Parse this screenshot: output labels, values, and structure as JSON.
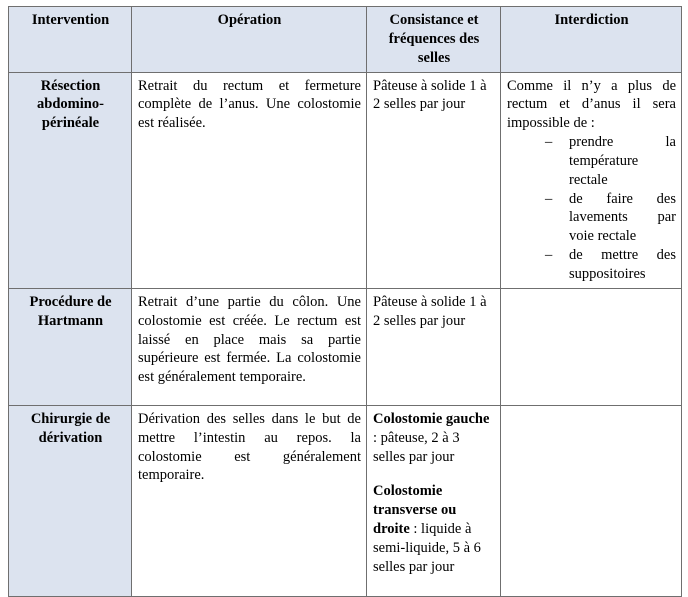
{
  "table": {
    "headers": [
      {
        "id": "intervention",
        "label": "Intervention"
      },
      {
        "id": "operation",
        "label": "Opération"
      },
      {
        "id": "consistance",
        "label": "Consistance et fréquences des selles"
      },
      {
        "id": "interdiction",
        "label": "Interdiction"
      }
    ],
    "rows": [
      {
        "intervention": "Résection abdomino-périnéale",
        "operation": "Retrait du rectum et fermeture complète de l’anus. Une colostomie est réalisée.",
        "consistance": [
          {
            "lead": "",
            "text": "Pâteuse à solide 1 à 2 selles par jour"
          }
        ],
        "interdiction_intro": "Comme il n’y a plus de rectum et d’anus il sera impossible de :",
        "interdiction_items": [
          "prendre la température rectale",
          "de faire des lavements par voie rectale",
          "de mettre des suppositoires"
        ],
        "dash": "–"
      },
      {
        "intervention": "Procédure de Hartmann",
        "operation": "Retrait d’une partie du côlon. Une colostomie est créée. Le rectum est laissé en place mais sa partie supérieure est fermée. La colostomie est généralement temporaire.",
        "consistance": [
          {
            "lead": "",
            "text": "Pâteuse à solide 1 à 2 selles par jour"
          }
        ],
        "interdiction_intro": "",
        "interdiction_items": [],
        "dash": "–"
      },
      {
        "intervention": "Chirurgie de dérivation",
        "operation": "Dérivation des selles dans le but de mettre l’intestin au repos. la colostomie est généralement temporaire.",
        "consistance": [
          {
            "lead": "Colostomie gauche",
            "text": " : pâteuse, 2 à 3 selles par jour"
          },
          {
            "lead": "Colostomie transverse ou droite",
            "text": " : liquide à semi-liquide, 5 à 6 selles par jour"
          }
        ],
        "interdiction_intro": "",
        "interdiction_items": [],
        "dash": "–"
      }
    ]
  },
  "colors": {
    "header_fill": "#dce3ef",
    "border": "#6f6f6f",
    "text": "#000000"
  }
}
